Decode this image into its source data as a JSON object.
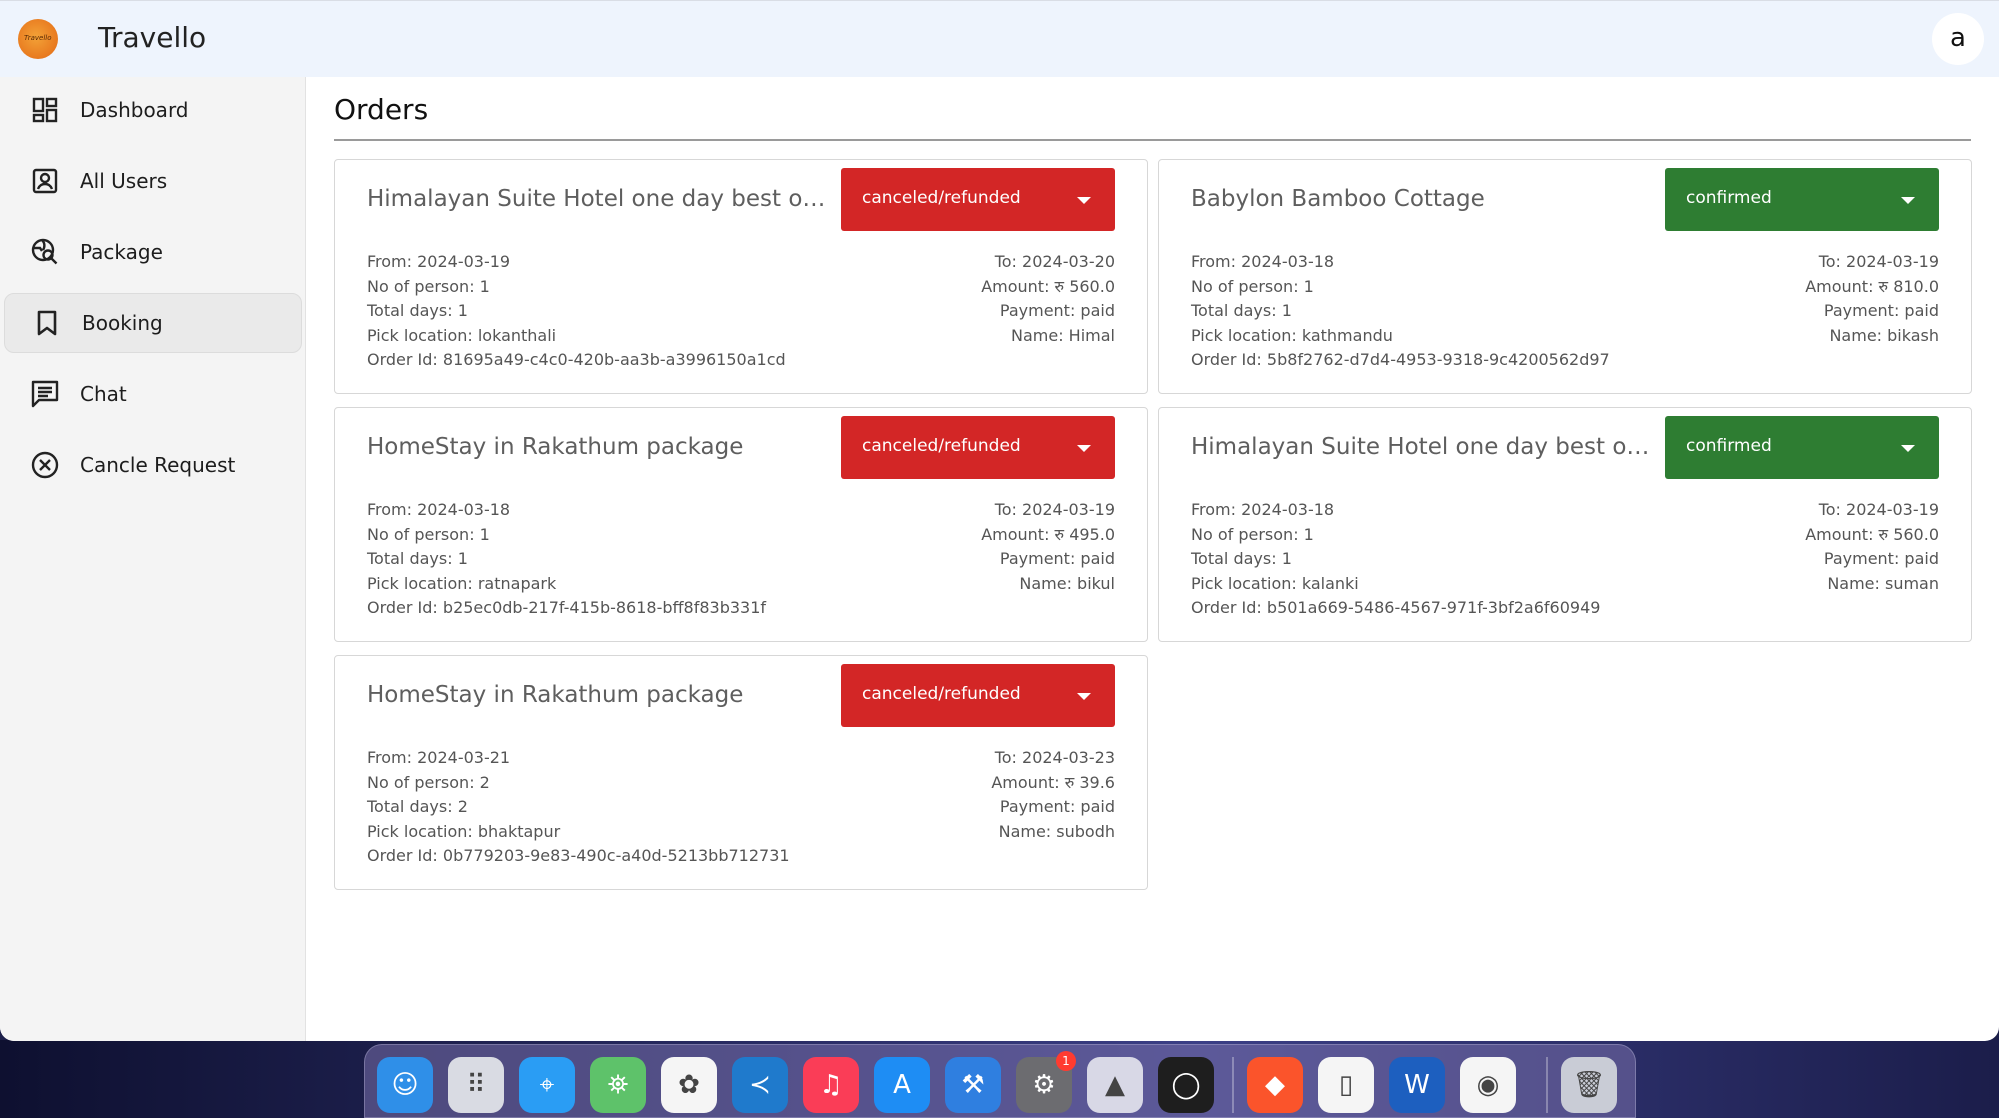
{
  "app": {
    "title": "Travello",
    "logo_text": "Travello",
    "avatar_letter": "a"
  },
  "sidebar": {
    "items": [
      {
        "label": "Dashboard",
        "icon": "dashboard-icon",
        "active": false
      },
      {
        "label": "All Users",
        "icon": "user-box-icon",
        "active": false
      },
      {
        "label": "Package",
        "icon": "travel-search-icon",
        "active": false
      },
      {
        "label": "Booking",
        "icon": "bookmark-icon",
        "active": true
      },
      {
        "label": "Chat",
        "icon": "chat-icon",
        "active": false
      },
      {
        "label": "Cancle Request",
        "icon": "cancel-circle-icon",
        "active": false
      }
    ]
  },
  "main": {
    "title": "Orders"
  },
  "orders": [
    {
      "title": "Himalayan Suite Hotel one day best offer",
      "status": "canceled/refunded",
      "status_color": "#d32626",
      "from": "From: 2024-03-19",
      "to": "To: 2024-03-20",
      "persons": "No of person: 1",
      "amount": "Amount: रु 560.0",
      "days": "Total days: 1",
      "payment": "Payment: paid",
      "pick": "Pick location: lokanthali",
      "name": "Name: Himal",
      "order_id": "Order Id: 81695a49-c4c0-420b-aa3b-a3996150a1cd"
    },
    {
      "title": "Babylon Bamboo Cottage",
      "status": "confirmed",
      "status_color": "#2e7d32",
      "from": "From: 2024-03-18",
      "to": "To: 2024-03-19",
      "persons": "No of person: 1",
      "amount": "Amount: रु 810.0",
      "days": "Total days: 1",
      "payment": "Payment: paid",
      "pick": "Pick location: kathmandu",
      "name": "Name: bikash",
      "order_id": "Order Id: 5b8f2762-d7d4-4953-9318-9c4200562d97"
    },
    {
      "title": "HomeStay in Rakathum package",
      "status": "canceled/refunded",
      "status_color": "#d32626",
      "from": "From: 2024-03-18",
      "to": "To: 2024-03-19",
      "persons": "No of person: 1",
      "amount": "Amount: रु 495.0",
      "days": "Total days: 1",
      "payment": "Payment: paid",
      "pick": "Pick location: ratnapark",
      "name": "Name: bikul",
      "order_id": "Order Id: b25ec0db-217f-415b-8618-bff8f83b331f"
    },
    {
      "title": "Himalayan Suite Hotel one day best offer",
      "status": "confirmed",
      "status_color": "#2e7d32",
      "from": "From: 2024-03-18",
      "to": "To: 2024-03-19",
      "persons": "No of person: 1",
      "amount": "Amount: रु 560.0",
      "days": "Total days: 1",
      "payment": "Payment: paid",
      "pick": "Pick location: kalanki",
      "name": "Name: suman",
      "order_id": "Order Id: b501a669-5486-4567-971f-3bf2a6f60949"
    },
    {
      "title": "HomeStay in Rakathum package",
      "status": "canceled/refunded",
      "status_color": "#d32626",
      "from": "From: 2024-03-21",
      "to": "To: 2024-03-23",
      "persons": "No of person: 2",
      "amount": "Amount: रु 39.6",
      "days": "Total days: 2",
      "payment": "Payment: paid",
      "pick": "Pick location: bhaktapur",
      "name": "Name: subodh",
      "order_id": "Order Id: 0b779203-9e83-490c-a40d-5213bb712731"
    }
  ],
  "dock": {
    "apps": [
      {
        "name": "finder",
        "glyph": "☺",
        "color": "#2f8fe8"
      },
      {
        "name": "launchpad",
        "glyph": "⠿",
        "color": "#d9dbe3"
      },
      {
        "name": "safari",
        "glyph": "⌖",
        "color": "#2a9df4"
      },
      {
        "name": "maps",
        "glyph": "⛯",
        "color": "#5ec26a"
      },
      {
        "name": "photos",
        "glyph": "✿",
        "color": "#f5f5f5"
      },
      {
        "name": "vscode",
        "glyph": "≺",
        "color": "#1f7acc"
      },
      {
        "name": "music",
        "glyph": "♫",
        "color": "#fa3d57"
      },
      {
        "name": "app-store",
        "glyph": "A",
        "color": "#1e8df4"
      },
      {
        "name": "xcode",
        "glyph": "⚒",
        "color": "#2f7fe0"
      },
      {
        "name": "system-settings",
        "glyph": "⚙",
        "color": "#6c6c70",
        "badge": "1"
      },
      {
        "name": "affinity",
        "glyph": "▲",
        "color": "#d8d8e6"
      },
      {
        "name": "activity-ring",
        "glyph": "◯",
        "color": "#1e1e1e"
      },
      {
        "name": "brave",
        "glyph": "◆",
        "color": "#fb542b"
      },
      {
        "name": "simulator",
        "glyph": "▯",
        "color": "#f5f5f5"
      },
      {
        "name": "word",
        "glyph": "W",
        "color": "#1d5fbf"
      },
      {
        "name": "chrome",
        "glyph": "◉",
        "color": "#f5f5f5"
      },
      {
        "name": "trash",
        "glyph": "🗑",
        "color": "#c9ccd6"
      }
    ]
  }
}
